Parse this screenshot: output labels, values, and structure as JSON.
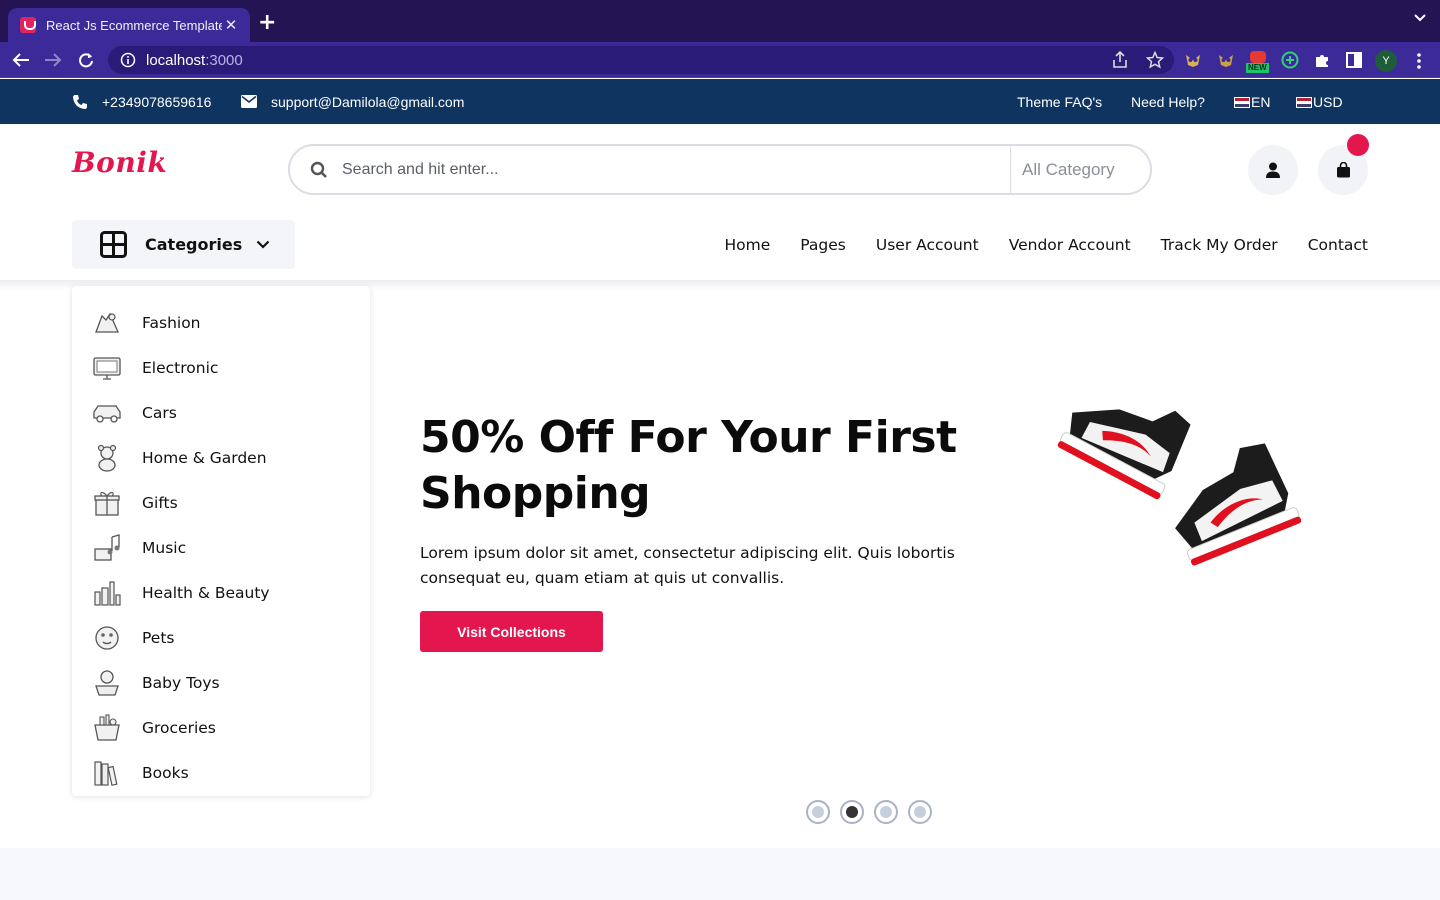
{
  "browser": {
    "tab_title": "React Js Ecommerce Template",
    "url_host": "localhost",
    "url_port": ":3000",
    "profile_initial": "Y",
    "ext_badge_text": "NEW"
  },
  "topbar": {
    "phone": "+2349078659616",
    "email": "support@Damilola@gmail.com",
    "links": [
      "Theme FAQ's",
      "Need Help?"
    ],
    "language": "EN",
    "currency": "USD"
  },
  "header": {
    "logo": "Bonik",
    "search_placeholder": "Search and hit enter...",
    "search_category": "All Category"
  },
  "nav": {
    "categories_label": "Categories",
    "items": [
      "Home",
      "Pages",
      "User Account",
      "Vendor Account",
      "Track My Order",
      "Contact"
    ]
  },
  "categories": [
    {
      "label": "Fashion",
      "icon": "fashion-icon"
    },
    {
      "label": "Electronic",
      "icon": "electronic-icon"
    },
    {
      "label": "Cars",
      "icon": "car-icon"
    },
    {
      "label": "Home & Garden",
      "icon": "teddy-bear-icon"
    },
    {
      "label": "Gifts",
      "icon": "gift-icon"
    },
    {
      "label": "Music",
      "icon": "music-icon"
    },
    {
      "label": "Health & Beauty",
      "icon": "beauty-icon"
    },
    {
      "label": "Pets",
      "icon": "pets-icon"
    },
    {
      "label": "Baby Toys",
      "icon": "baby-toys-icon"
    },
    {
      "label": "Groceries",
      "icon": "groceries-icon"
    },
    {
      "label": "Books",
      "icon": "books-icon"
    }
  ],
  "hero": {
    "title": "50% Off For Your First Shopping",
    "text": "Lorem ipsum dolor sit amet, consectetur adipiscing elit. Quis lobortis consequat eu, quam etiam at quis ut convallis.",
    "cta": "Visit Collections",
    "slides_total": 4,
    "active_slide": 2
  },
  "colors": {
    "brand": "#e3164e",
    "topbar": "#0f3460",
    "browser_frame": "#241454",
    "browser_toolbar": "#3b2a98"
  }
}
